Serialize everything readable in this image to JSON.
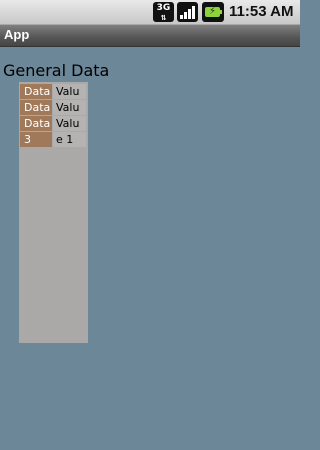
{
  "status_bar": {
    "network_label": "3G",
    "network_icon": "3g-data-icon",
    "signal_icon": "signal-strength-icon",
    "battery_icon": "battery-charging-icon",
    "time": "11:53 AM"
  },
  "app_bar": {
    "title": "App"
  },
  "content": {
    "heading": "General Data",
    "table": {
      "rows": [
        {
          "label": "Data",
          "value": "Valu"
        },
        {
          "label": "Data",
          "value": "Valu"
        },
        {
          "label": "Data",
          "value": "Valu"
        },
        {
          "label": "3",
          "value": "e 1"
        }
      ]
    }
  },
  "colors": {
    "background": "#6c8797",
    "panel": "#aaa9a8",
    "header_cell": "#a0795a",
    "value_cell": "#b4b3b2"
  }
}
